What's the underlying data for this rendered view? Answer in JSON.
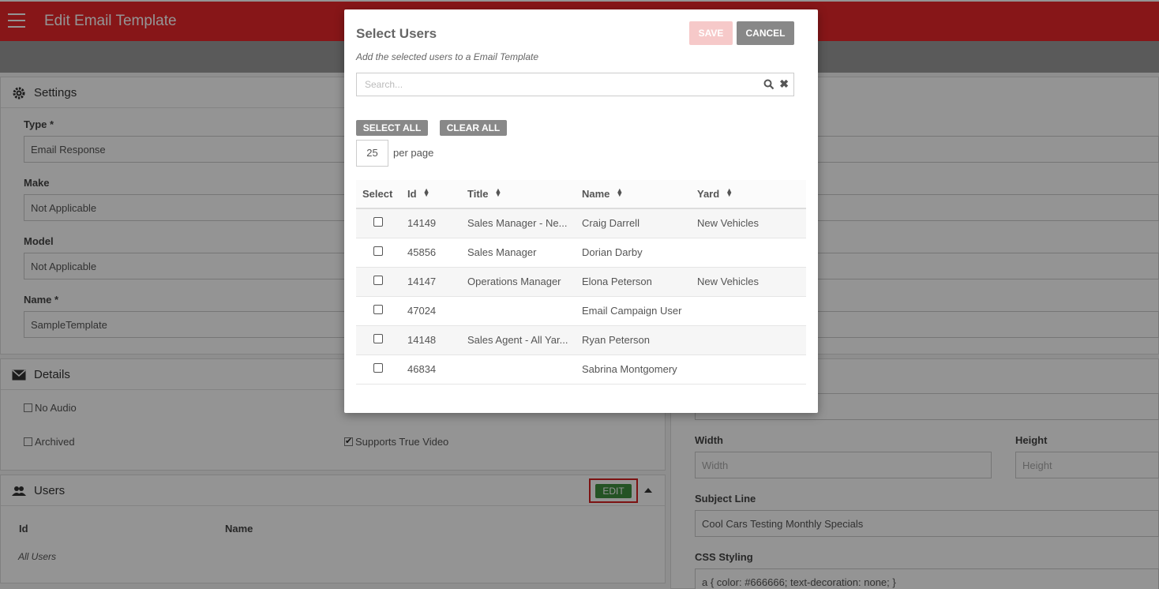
{
  "app": {
    "title": "Edit Email Template"
  },
  "settings": {
    "title": "Settings",
    "type_label": "Type *",
    "type_value": "Email Response",
    "make_label": "Make",
    "make_value": "Not Applicable",
    "model_label": "Model",
    "model_value": "Not Applicable",
    "name_label": "Name *",
    "name_value": "SampleTemplate"
  },
  "details": {
    "title": "Details",
    "no_audio": "No Audio",
    "archived": "Archived",
    "supports_true_video": "Supports True Video"
  },
  "users_panel": {
    "title": "Users",
    "edit_label": "EDIT",
    "col_id": "Id",
    "col_name": "Name",
    "empty_text": "All Users"
  },
  "right_form": {
    "width_label": "Width",
    "width_placeholder": "Width",
    "height_label": "Height",
    "height_placeholder": "Height",
    "subject_label": "Subject Line",
    "subject_value": "Cool Cars Testing Monthly Specials",
    "css_label": "CSS Styling",
    "css_value": "a { color: #666666; text-decoration: none; }"
  },
  "modal": {
    "title": "Select Users",
    "subtitle": "Add the selected users to a Email Template",
    "save_label": "SAVE",
    "cancel_label": "CANCEL",
    "search_placeholder": "Search...",
    "select_all_label": "SELECT ALL",
    "clear_all_label": "CLEAR ALL",
    "per_page_value": "25",
    "per_page_label": "per page",
    "columns": {
      "select": "Select",
      "id": "Id",
      "title": "Title",
      "name": "Name",
      "yard": "Yard"
    },
    "rows": [
      {
        "id": "14149",
        "title": "Sales Manager - Ne...",
        "name": "Craig Darrell",
        "yard": "New Vehicles"
      },
      {
        "id": "45856",
        "title": "Sales Manager",
        "name": "Dorian Darby",
        "yard": ""
      },
      {
        "id": "14147",
        "title": "Operations Manager",
        "name": "Elona Peterson",
        "yard": "New Vehicles"
      },
      {
        "id": "47024",
        "title": "",
        "name": "Email Campaign User",
        "yard": ""
      },
      {
        "id": "14148",
        "title": "Sales Agent - All Yar...",
        "name": "Ryan Peterson",
        "yard": ""
      },
      {
        "id": "46834",
        "title": "",
        "name": "Sabrina Montgomery",
        "yard": ""
      }
    ]
  },
  "colors": {
    "brand": "#e8262a",
    "edit_green": "#3f8f3f",
    "highlight": "#d62020"
  }
}
